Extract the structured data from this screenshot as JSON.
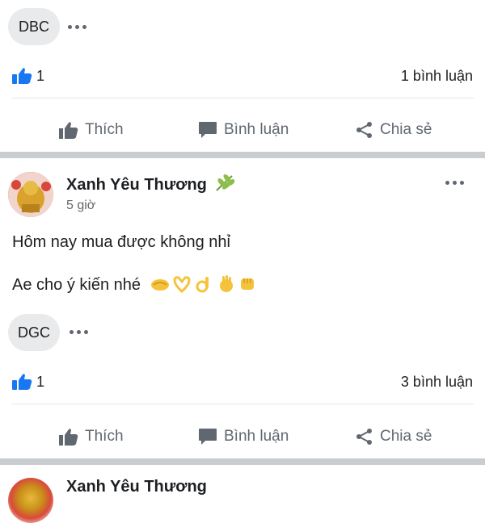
{
  "prev_post": {
    "tag": "DBC",
    "reaction_count": "1",
    "comment_count": "1 bình luận"
  },
  "actions": {
    "like": "Thích",
    "comment": "Bình luận",
    "share": "Chia sẻ"
  },
  "post": {
    "author": "Xanh Yêu Thương",
    "time": "5 giờ",
    "line1": "Hôm nay mua được không nhỉ",
    "line2": "Ae cho ý kiến nhé",
    "emojis": [
      "handshake",
      "heart-hands",
      "ok-hand",
      "waving-hand",
      "raised-fist"
    ],
    "tag": "DGC",
    "reaction_count": "1",
    "comment_count": "3 bình luận"
  },
  "next_post": {
    "author": "Xanh Yêu Thương"
  },
  "colors": {
    "like_blue": "#1877f2",
    "tag_bg": "#e9eaec",
    "separator": "#c9ccd1",
    "muted": "#65676b"
  }
}
